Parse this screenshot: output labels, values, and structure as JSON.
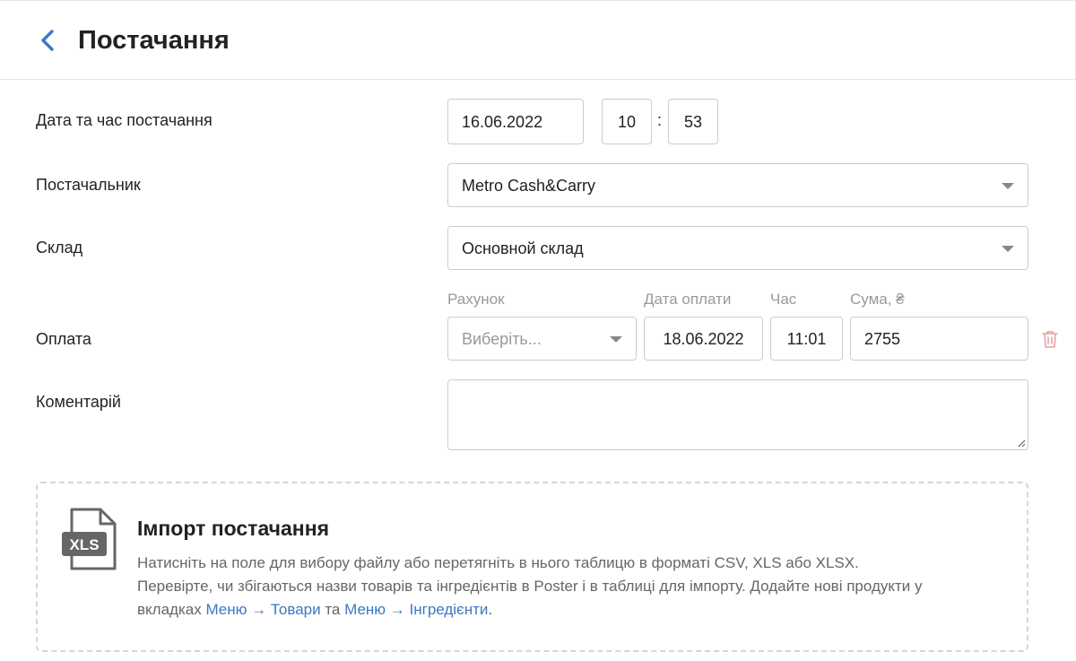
{
  "header": {
    "title": "Постачання",
    "back_icon": "chevron-left-icon"
  },
  "form": {
    "datetime": {
      "label": "Дата та час постачання",
      "date": "16.06.2022",
      "hour": "10",
      "separator": ":",
      "minute": "53"
    },
    "supplier": {
      "label": "Постачальник",
      "value": "Metro Cash&Carry"
    },
    "warehouse": {
      "label": "Склад",
      "value": "Основной склад"
    },
    "payment": {
      "label": "Оплата",
      "account_label": "Рахунок",
      "account_placeholder": "Виберіть...",
      "pay_date_label": "Дата оплати",
      "pay_date": "18.06.2022",
      "time_label": "Час",
      "time": "11:01",
      "sum_label": "Сума, ₴",
      "sum": "2755",
      "delete_icon": "trash-icon"
    },
    "comment": {
      "label": "Коментарій",
      "value": ""
    }
  },
  "import": {
    "icon_text": "XLS",
    "title": "Імпорт постачання",
    "line1": "Натисніть на поле для вибору файлу або перетягніть в нього таблицю в форматі CSV, XLS або XLSX.",
    "line2": "Перевірте, чи збігаються назви товарів та інгредієнтів в Poster і в таблиці для імпорту. Додайте нові продукти у",
    "line3_prefix": "вкладках ",
    "link_products": "Меню → Товари",
    "line3_middle": " та ",
    "link_ingredients": "Меню → Інгредієнти",
    "line3_suffix": "."
  },
  "colors": {
    "accent": "#3b78c2",
    "delete": "#e8a0a0",
    "border": "#cccccc"
  }
}
